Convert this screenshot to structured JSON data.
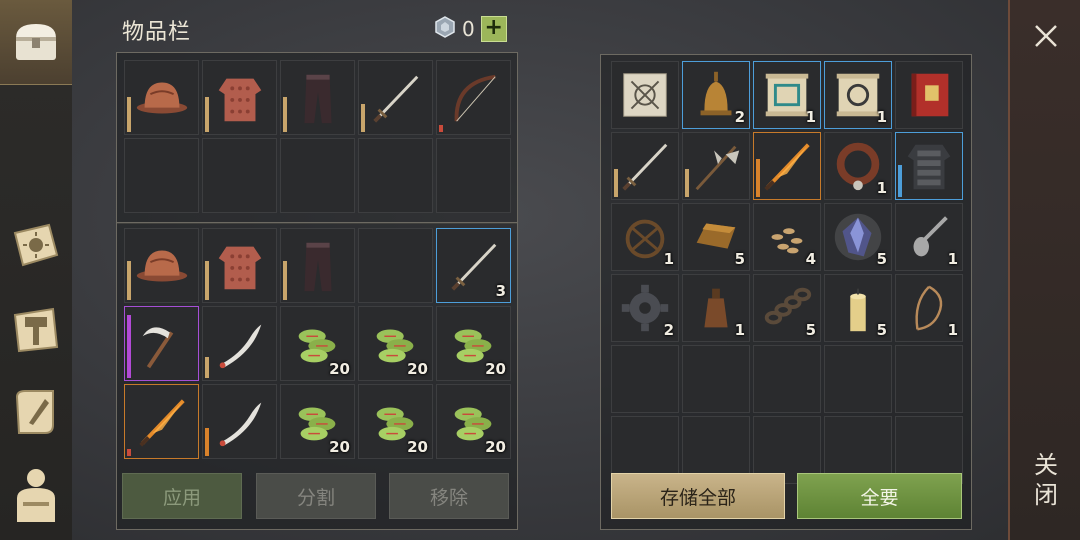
{
  "header": {
    "title": "物品栏",
    "currency_value": "0"
  },
  "left_nav": [
    {
      "name": "chest-icon"
    },
    {
      "name": "crafting-book-icon"
    },
    {
      "name": "build-hammer-icon"
    },
    {
      "name": "quest-scroll-icon"
    },
    {
      "name": "character-icon"
    }
  ],
  "equipment_slots": [
    {
      "item": "helmet",
      "durability_color": "#c8a56b",
      "durability": 0.5
    },
    {
      "item": "chainmail-shirt",
      "durability_color": "#c8a56b",
      "durability": 0.5
    },
    {
      "item": "pants",
      "durability_color": "#c8a56b",
      "durability": 0.5
    },
    {
      "item": "sword",
      "durability_color": "#c8a56b",
      "durability": 0.4
    },
    {
      "item": "bow",
      "durability_color": "#c94b3b",
      "durability": 0.1
    }
  ],
  "inventory": [
    {
      "item": "helmet",
      "count": "",
      "durability": 0.55,
      "color": "#c8a56b"
    },
    {
      "item": "chainmail-shirt",
      "count": "",
      "durability": 0.55,
      "color": "#c8a56b"
    },
    {
      "item": "pants",
      "count": "",
      "durability": 0.55,
      "color": "#c8a56b"
    },
    {
      "item": "",
      "count": ""
    },
    {
      "item": "sword",
      "count": "3",
      "border": "blue"
    },
    {
      "item": "scythe",
      "count": "",
      "durability": 0.9,
      "color": "#b24ad6",
      "border": "purple"
    },
    {
      "item": "saber",
      "count": "",
      "durability": 0.3,
      "color": "#c8a56b"
    },
    {
      "item": "green-coins",
      "count": "20"
    },
    {
      "item": "green-coins",
      "count": "20"
    },
    {
      "item": "green-coins",
      "count": "20"
    },
    {
      "item": "flame-sword",
      "count": "",
      "durability": 0.1,
      "color": "#c94b3b",
      "border": "orange"
    },
    {
      "item": "wavy-sword",
      "count": "",
      "durability": 0.4,
      "color": "#d9822b"
    },
    {
      "item": "green-coins",
      "count": "20"
    },
    {
      "item": "green-coins",
      "count": "20"
    },
    {
      "item": "green-coins",
      "count": "20"
    }
  ],
  "storage": [
    {
      "item": "paper-map",
      "count": ""
    },
    {
      "item": "bell",
      "count": "2",
      "border": "blue"
    },
    {
      "item": "teal-scroll",
      "count": "1",
      "border": "blue"
    },
    {
      "item": "dark-scroll",
      "count": "1",
      "border": "blue"
    },
    {
      "item": "red-book",
      "count": ""
    },
    {
      "item": "long-sword",
      "count": "",
      "durability": 0.45,
      "color": "#c8a56b"
    },
    {
      "item": "halberd",
      "count": "",
      "durability": 0.45,
      "color": "#c8a56b"
    },
    {
      "item": "flame-sword",
      "count": "",
      "durability": 0.6,
      "color": "#d9822b",
      "border": "orange"
    },
    {
      "item": "collar",
      "count": "1"
    },
    {
      "item": "plate-armor",
      "count": "",
      "durability": 0.5,
      "color": "#4d9ed9",
      "border": "blue"
    },
    {
      "item": "trap",
      "count": "1"
    },
    {
      "item": "bronze-ingot",
      "count": "5"
    },
    {
      "item": "seeds",
      "count": "4"
    },
    {
      "item": "crystal",
      "count": "5"
    },
    {
      "item": "spoon",
      "count": "1"
    },
    {
      "item": "gear",
      "count": "2"
    },
    {
      "item": "leather-flask",
      "count": "1"
    },
    {
      "item": "chain",
      "count": "5"
    },
    {
      "item": "candle",
      "count": "5"
    },
    {
      "item": "rope",
      "count": "1"
    },
    {
      "item": "",
      "count": ""
    },
    {
      "item": "",
      "count": ""
    },
    {
      "item": "",
      "count": ""
    },
    {
      "item": "",
      "count": ""
    },
    {
      "item": "",
      "count": ""
    },
    {
      "item": "",
      "count": ""
    },
    {
      "item": "",
      "count": ""
    },
    {
      "item": "",
      "count": ""
    },
    {
      "item": "",
      "count": ""
    },
    {
      "item": "",
      "count": ""
    }
  ],
  "buttons": {
    "apply": "应用",
    "split": "分割",
    "remove": "移除",
    "store_all": "存储全部",
    "take_all": "全要"
  },
  "close": {
    "label": "关闭"
  }
}
